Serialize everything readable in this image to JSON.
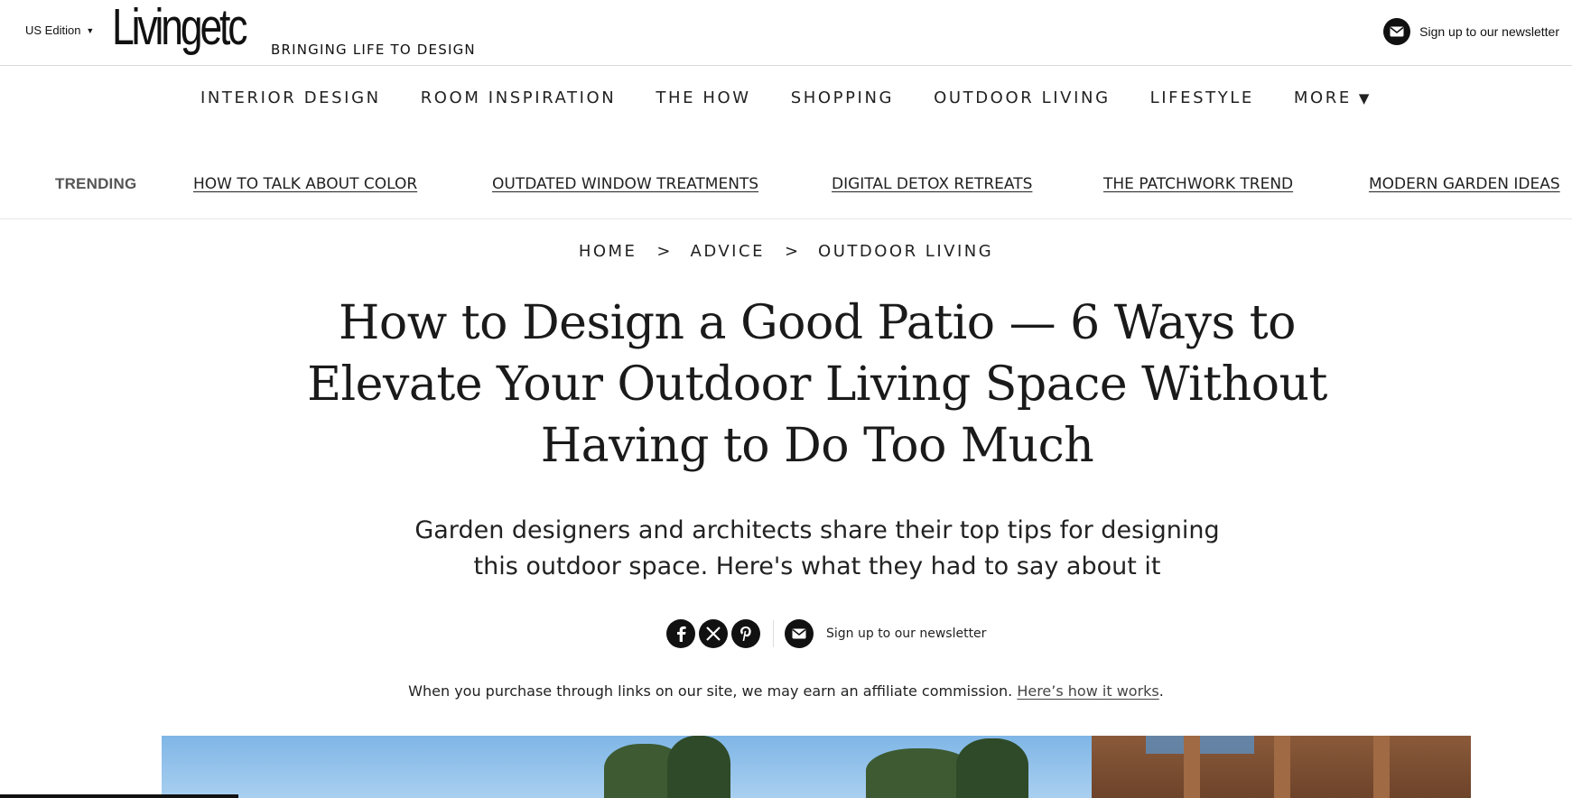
{
  "topbar": {
    "edition": "US Edition",
    "logo_text": "Livingetc",
    "tagline": "BRINGING LIFE TO DESIGN",
    "newsletter_label": "Sign up to our newsletter"
  },
  "nav": {
    "items": [
      "INTERIOR DESIGN",
      "ROOM INSPIRATION",
      "THE HOW",
      "SHOPPING",
      "OUTDOOR LIVING",
      "LIFESTYLE"
    ],
    "more_label": "MORE"
  },
  "trending": {
    "label": "TRENDING",
    "links": [
      "HOW TO TALK ABOUT COLOR",
      "OUTDATED WINDOW TREATMENTS",
      "DIGITAL DETOX RETREATS",
      "THE PATCHWORK TREND",
      "MODERN GARDEN IDEAS"
    ]
  },
  "breadcrumb": {
    "items": [
      "HOME",
      "ADVICE",
      "OUTDOOR LIVING"
    ],
    "separator": ">"
  },
  "article": {
    "headline": "How to Design a Good Patio — 6 Ways to Elevate Your Outdoor Living Space Without Having to Do Too Much",
    "standfirst": "Garden designers and architects share their top tips for designing this outdoor space. Here's what they had to say about it"
  },
  "share": {
    "icons": [
      "facebook-icon",
      "x-icon",
      "pinterest-icon",
      "mail-icon"
    ],
    "newsletter_label": "Sign up to our newsletter"
  },
  "affiliate": {
    "text": "When you purchase through links on our site, we may earn an affiliate commission.",
    "link_text": "Here’s how it works",
    "end": "."
  },
  "colors": {
    "logo_dot": "#d0021b",
    "icon_bg": "#111111",
    "text": "#222222"
  }
}
